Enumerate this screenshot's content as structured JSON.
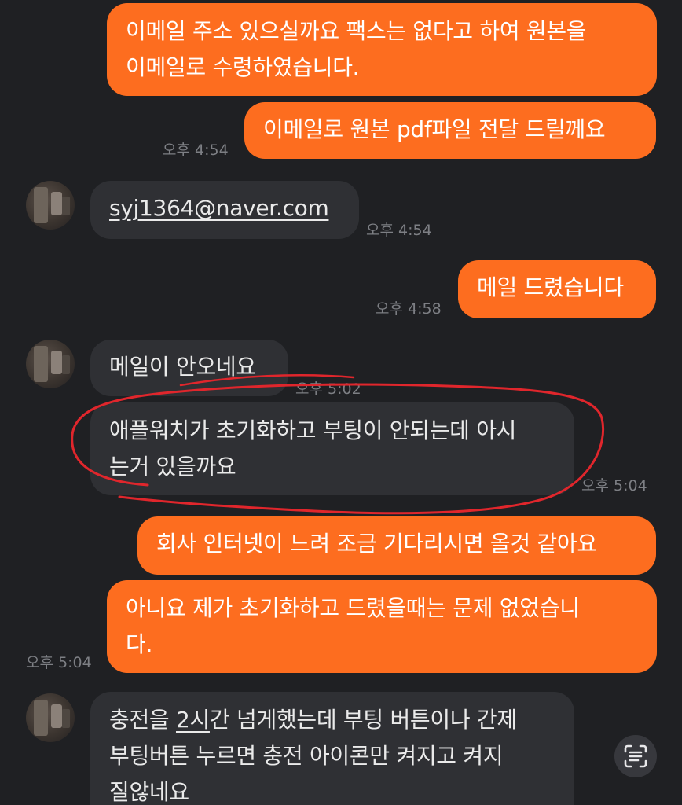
{
  "messages": {
    "m1": {
      "line1": "이메일 주소 있으실까요 팩스는 없다고 하여 원본을",
      "line2": "이메일로 수령하였습니다."
    },
    "m2": {
      "text": "이메일로 원본 pdf파일 전달 드릴께요",
      "time": "오후 4:54"
    },
    "m3": {
      "text": "syj1364@naver.com",
      "time": "오후 4:54"
    },
    "m4": {
      "text": "메일 드렸습니다",
      "time": "오후 4:58"
    },
    "m5": {
      "text": "메일이 안오네요",
      "time": "오후 5:02"
    },
    "m6": {
      "line1": "애플워치가 초기화하고 부팅이 안되는데 아시",
      "line2": "는거 있을까요",
      "time": "오후 5:04"
    },
    "m7": {
      "text": "회사 인터넷이 느려 조금 기다리시면 올것 같아요"
    },
    "m8": {
      "line1": "아니요 제가 초기화하고 드렸을때는 문제 없었습니",
      "line2": "다.",
      "time": "오후 5:04"
    },
    "m9": {
      "line1_a": "충전을 ",
      "line1_b": "2시",
      "line1_c": "간 넘게했는데 부팅 버튼이나 간제",
      "line2": "부팅버튼 누르면 충전 아이콘만 켜지고 켜지",
      "line3": "질않네요"
    }
  },
  "icons": {
    "scan": "text-scan-icon",
    "avatar": "contact-avatar"
  },
  "colors": {
    "background": "#1f2023",
    "outgoing_bubble": "#fd6d1f",
    "incoming_bubble": "#2f3034",
    "annotation": "#e0262c"
  }
}
